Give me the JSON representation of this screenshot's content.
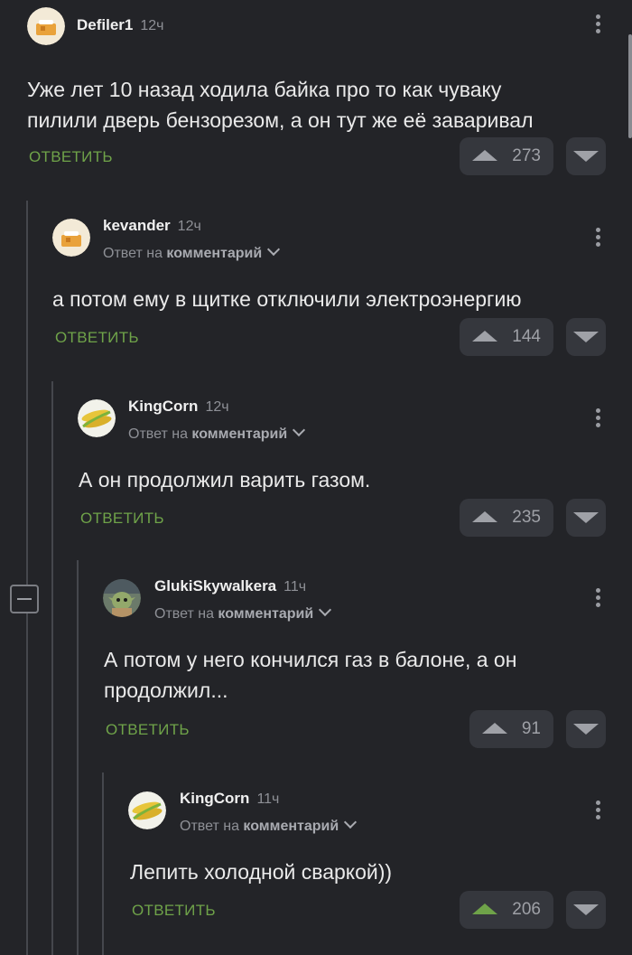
{
  "comments": [
    {
      "author": "Defiler1",
      "time": "12ч",
      "reply_to": null,
      "text_lines": [
        "Уже лет 10 назад ходила байка про то как чуваку",
        "пилили дверь бензорезом, а он тут же её заваривал"
      ],
      "reply_label": "ОТВЕТИТЬ",
      "votes": "273",
      "upvoted": false
    },
    {
      "author": "kevander",
      "time": "12ч",
      "reply_to": {
        "prefix": "Ответ на",
        "target": "комментарий"
      },
      "text_lines": [
        "а потом ему в щитке отключили электроэнергию"
      ],
      "reply_label": "ОТВЕТИТЬ",
      "votes": "144",
      "upvoted": false
    },
    {
      "author": "KingCorn",
      "time": "12ч",
      "reply_to": {
        "prefix": "Ответ на",
        "target": "комментарий"
      },
      "text_lines": [
        "А он продолжил варить газом."
      ],
      "reply_label": "ОТВЕТИТЬ",
      "votes": "235",
      "upvoted": false
    },
    {
      "author": "GlukiSkywalkera",
      "time": "11ч",
      "reply_to": {
        "prefix": "Ответ на",
        "target": "комментарий"
      },
      "text_lines": [
        "А потом у него кончился газ в балоне, а он",
        "продолжил..."
      ],
      "reply_label": "ОТВЕТИТЬ",
      "votes": "91",
      "upvoted": false
    },
    {
      "author": "KingCorn",
      "time": "11ч",
      "reply_to": {
        "prefix": "Ответ на",
        "target": "комментарий"
      },
      "text_lines": [
        "Лепить холодной сваркой))"
      ],
      "reply_label": "ОТВЕТИТЬ",
      "votes": "206",
      "upvoted": true
    }
  ],
  "colors": {
    "background": "#232428",
    "accent": "#6fa349",
    "muted": "#8e9096"
  }
}
